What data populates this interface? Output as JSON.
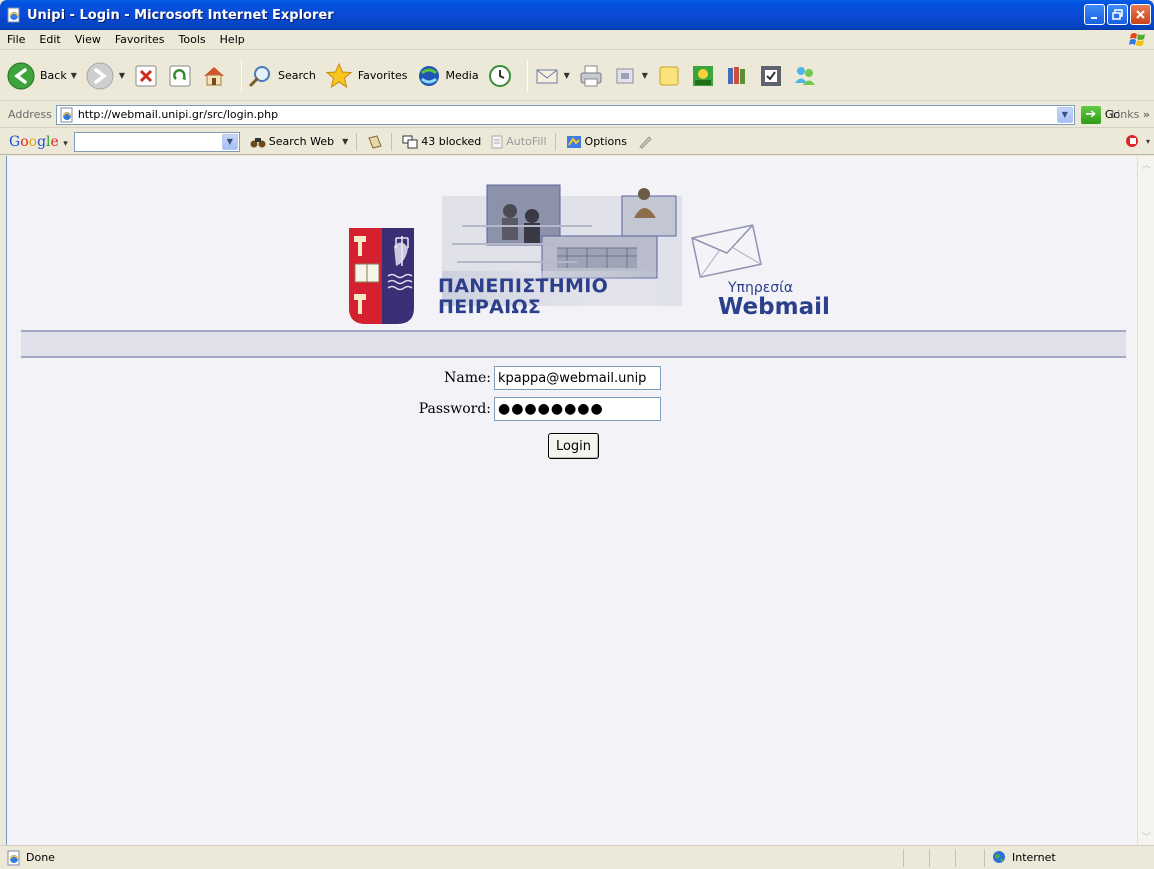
{
  "window": {
    "title": "Unipi - Login - Microsoft Internet Explorer",
    "controls": [
      "minimize-icon",
      "maximize-icon",
      "close-icon"
    ]
  },
  "menu": {
    "items": [
      "File",
      "Edit",
      "View",
      "Favorites",
      "Tools",
      "Help"
    ]
  },
  "toolbar": {
    "back_label": "Back",
    "search_label": "Search",
    "favorites_label": "Favorites",
    "media_label": "Media"
  },
  "address_bar": {
    "label": "Address",
    "url": "http://webmail.unipi.gr/src/login.php",
    "go_label": "Go",
    "links_label": "Links"
  },
  "google_toolbar": {
    "search_web_label": "Search Web",
    "blocked_label": "43 blocked",
    "autofill_label": "AutoFill",
    "options_label": "Options"
  },
  "page": {
    "university_line1": "ΠΑΝΕΠΙΣΤΗΜΙΟ",
    "university_line2": "ΠΕΙΡΑΙΩΣ",
    "service_line1": "Υπηρεσία",
    "service_line2": "Webmail",
    "form": {
      "name_label": "Name:",
      "name_value": "kpappa@webmail.unip",
      "password_label": "Password:",
      "password_value": "●●●●●●●●",
      "login_label": "Login"
    }
  },
  "status_bar": {
    "status": "Done",
    "zone": "Internet"
  },
  "colors": {
    "titlebar_blue": "#0A4AD6",
    "brand_navy": "#2B3F8B",
    "shield_red": "#D5212F",
    "content_bg": "#F3F3F7"
  }
}
